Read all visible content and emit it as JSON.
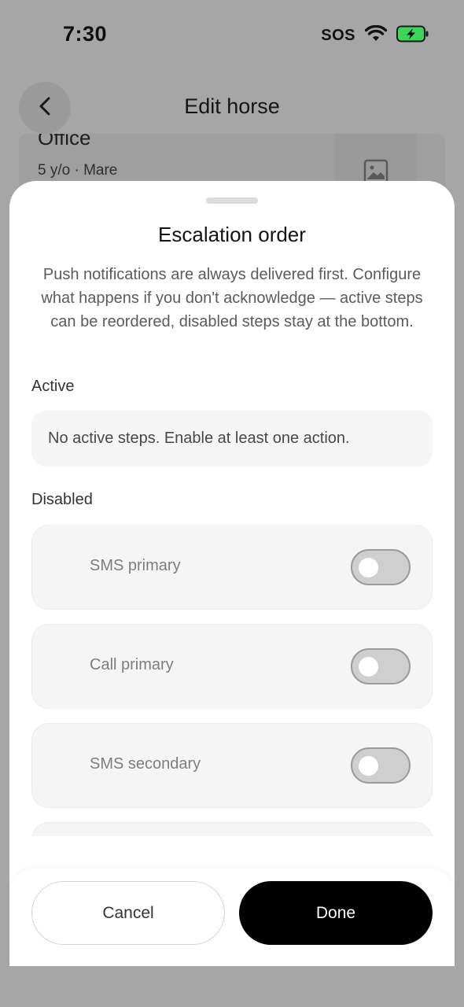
{
  "status_bar": {
    "time": "7:30",
    "carrier": "SOS"
  },
  "background": {
    "nav": {
      "title": "Edit horse"
    },
    "horse_card": {
      "name": "Office",
      "meta": "5 y/o · Mare"
    }
  },
  "sheet": {
    "title": "Escalation order",
    "description": "Push notifications are always delivered first. Configure what happens if you don't acknowledge — active steps can be reordered, disabled steps stay at the bottom.",
    "active_section": {
      "label": "Active",
      "empty_text": "No active steps. Enable at least one action."
    },
    "disabled_section": {
      "label": "Disabled",
      "steps": [
        {
          "label": "SMS primary",
          "enabled": false
        },
        {
          "label": "Call primary",
          "enabled": false
        },
        {
          "label": "SMS secondary",
          "enabled": false
        }
      ]
    }
  },
  "footer": {
    "cancel_label": "Cancel",
    "done_label": "Done"
  },
  "colors": {
    "done_button": "#000000",
    "toggle_off": "#cfcfcf",
    "backdrop": "#a6a6a6"
  }
}
